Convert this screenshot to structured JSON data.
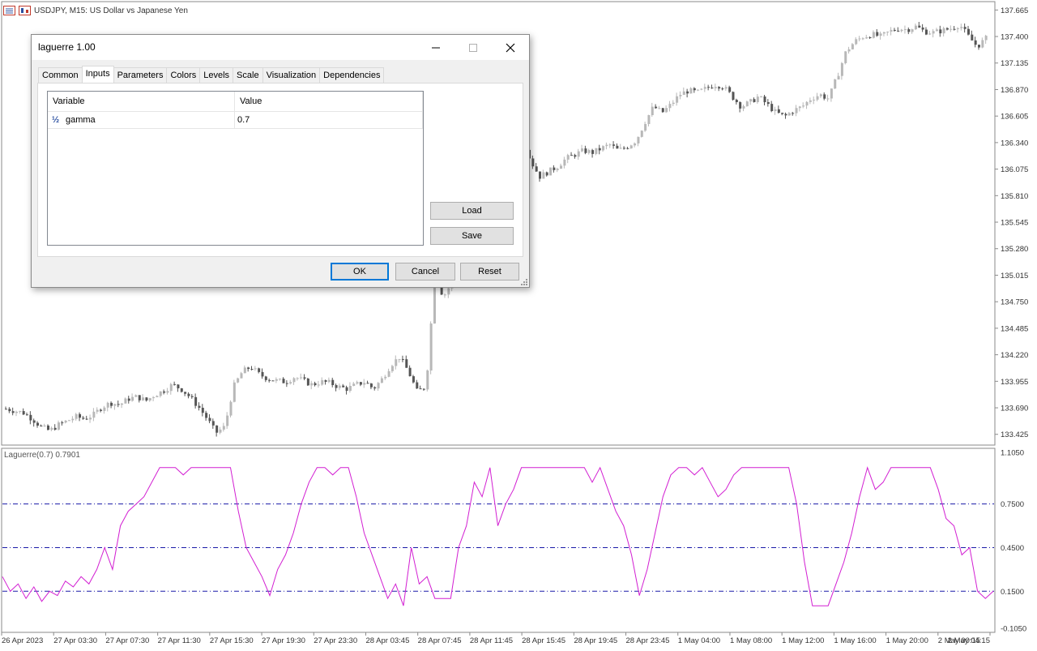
{
  "window": {
    "symbol_title": "USDJPY, M15:  US Dollar vs Japanese Yen"
  },
  "indicator": {
    "label": "Laguerre(0.7) 0.7901",
    "line_color": "#d21fd2",
    "level_color": "#1a1aa8"
  },
  "price_axis": {
    "labels": [
      "137.665",
      "137.400",
      "137.135",
      "136.870",
      "136.605",
      "136.340",
      "136.075",
      "135.810",
      "135.545",
      "135.280",
      "135.015",
      "134.750",
      "134.485",
      "134.220",
      "133.955",
      "133.690",
      "133.425"
    ],
    "min": 133.35,
    "max": 137.7
  },
  "indicator_axis": {
    "labels": [
      "1.1050",
      "0.7500",
      "0.4500",
      "0.1500",
      "-0.1050"
    ],
    "levels": [
      0.75,
      0.45,
      0.15
    ],
    "min": -0.105,
    "max": 1.105
  },
  "time_axis": {
    "labels": [
      "26 Apr 2023",
      "27 Apr 03:30",
      "27 Apr 07:30",
      "27 Apr 11:30",
      "27 Apr 15:30",
      "27 Apr 19:30",
      "27 Apr 23:30",
      "28 Apr 03:45",
      "28 Apr 07:45",
      "28 Apr 11:45",
      "28 Apr 15:45",
      "28 Apr 19:45",
      "28 Apr 23:45",
      "1 May 04:00",
      "1 May 08:00",
      "1 May 12:00",
      "1 May 16:00",
      "1 May 20:00",
      "2 May 00:15",
      "2 May 04:15"
    ]
  },
  "chart_data": [
    {
      "type": "candlestick",
      "title": "USDJPY, M15:  US Dollar vs Japanese Yen",
      "y_range": [
        133.35,
        137.7
      ],
      "close_path": [
        133.68,
        133.66,
        133.64,
        133.58,
        133.5,
        133.46,
        133.52,
        133.56,
        133.6,
        133.58,
        133.62,
        133.7,
        133.74,
        133.72,
        133.78,
        133.8,
        133.76,
        133.82,
        133.86,
        133.92,
        133.88,
        133.8,
        133.7,
        133.58,
        133.44,
        133.5,
        133.9,
        134.05,
        134.1,
        134.02,
        133.98,
        133.96,
        133.95,
        134.0,
        133.96,
        133.92,
        133.95,
        133.94,
        133.9,
        133.88,
        133.92,
        133.95,
        133.88,
        133.98,
        134.12,
        134.2,
        134.05,
        133.85,
        133.9,
        135.0,
        134.8,
        134.95,
        135.1,
        135.3,
        135.5,
        135.7,
        135.9,
        136.1,
        136.3,
        136.4,
        136.15,
        136.0,
        136.05,
        136.1,
        136.18,
        136.22,
        136.26,
        136.24,
        136.28,
        136.32,
        136.26,
        136.3,
        136.36,
        136.54,
        136.7,
        136.64,
        136.72,
        136.82,
        136.86,
        136.84,
        136.88,
        136.92,
        136.9,
        136.8,
        136.7,
        136.74,
        136.8,
        136.72,
        136.64,
        136.6,
        136.66,
        136.7,
        136.78,
        136.82,
        136.78,
        137.0,
        137.25,
        137.35,
        137.4,
        137.42,
        137.4,
        137.45,
        137.48,
        137.47,
        137.5,
        137.45,
        137.44,
        137.46,
        137.48,
        137.52,
        137.4,
        137.3,
        137.38
      ],
      "y_ticks": [
        "137.665",
        "137.400",
        "137.135",
        "136.870",
        "136.605",
        "136.340",
        "136.075",
        "135.810",
        "135.545",
        "135.280",
        "135.015",
        "134.750",
        "134.485",
        "134.220",
        "133.955",
        "133.690",
        "133.425"
      ]
    },
    {
      "type": "line",
      "title": "Laguerre(0.7) 0.7901",
      "y_range": [
        -0.105,
        1.105
      ],
      "levels": [
        0.75,
        0.45,
        0.15
      ],
      "values": [
        0.25,
        0.15,
        0.2,
        0.1,
        0.18,
        0.08,
        0.15,
        0.12,
        0.22,
        0.18,
        0.25,
        0.2,
        0.3,
        0.45,
        0.3,
        0.6,
        0.7,
        0.75,
        0.8,
        0.9,
        1.0,
        1.0,
        1.0,
        0.95,
        1.0,
        1.0,
        1.0,
        1.0,
        1.0,
        1.0,
        0.7,
        0.45,
        0.35,
        0.25,
        0.12,
        0.3,
        0.4,
        0.55,
        0.75,
        0.9,
        1.0,
        1.0,
        0.95,
        1.0,
        1.0,
        0.8,
        0.55,
        0.4,
        0.25,
        0.1,
        0.2,
        0.05,
        0.45,
        0.2,
        0.25,
        0.1,
        0.1,
        0.1,
        0.45,
        0.6,
        0.9,
        0.8,
        1.0,
        0.6,
        0.75,
        0.85,
        1.0,
        1.0,
        1.0,
        1.0,
        1.0,
        1.0,
        1.0,
        1.0,
        1.0,
        0.9,
        1.0,
        0.85,
        0.7,
        0.6,
        0.4,
        0.12,
        0.3,
        0.55,
        0.8,
        0.95,
        1.0,
        1.0,
        0.95,
        1.0,
        0.9,
        0.8,
        0.85,
        0.95,
        1.0,
        1.0,
        1.0,
        1.0,
        1.0,
        1.0,
        1.0,
        0.75,
        0.35,
        0.05,
        0.05,
        0.05,
        0.2,
        0.35,
        0.55,
        0.8,
        1.0,
        0.85,
        0.9,
        1.0,
        1.0,
        1.0,
        1.0,
        1.0,
        1.0,
        0.85,
        0.65,
        0.6,
        0.4,
        0.45,
        0.15,
        0.1,
        0.15
      ],
      "y_ticks": [
        "1.1050",
        "0.7500",
        "0.4500",
        "0.1500",
        "-0.1050"
      ]
    }
  ],
  "dialog": {
    "title": "laguerre 1.00",
    "tabs": [
      "Common",
      "Inputs",
      "Parameters",
      "Colors",
      "Levels",
      "Scale",
      "Visualization",
      "Dependencies"
    ],
    "active_tab": "Inputs",
    "table": {
      "headers": [
        "Variable",
        "Value"
      ],
      "rows": [
        {
          "icon": "½",
          "variable": "gamma",
          "value": "0.7"
        }
      ]
    },
    "buttons": {
      "load": "Load",
      "save": "Save",
      "ok": "OK",
      "cancel": "Cancel",
      "reset": "Reset"
    }
  }
}
